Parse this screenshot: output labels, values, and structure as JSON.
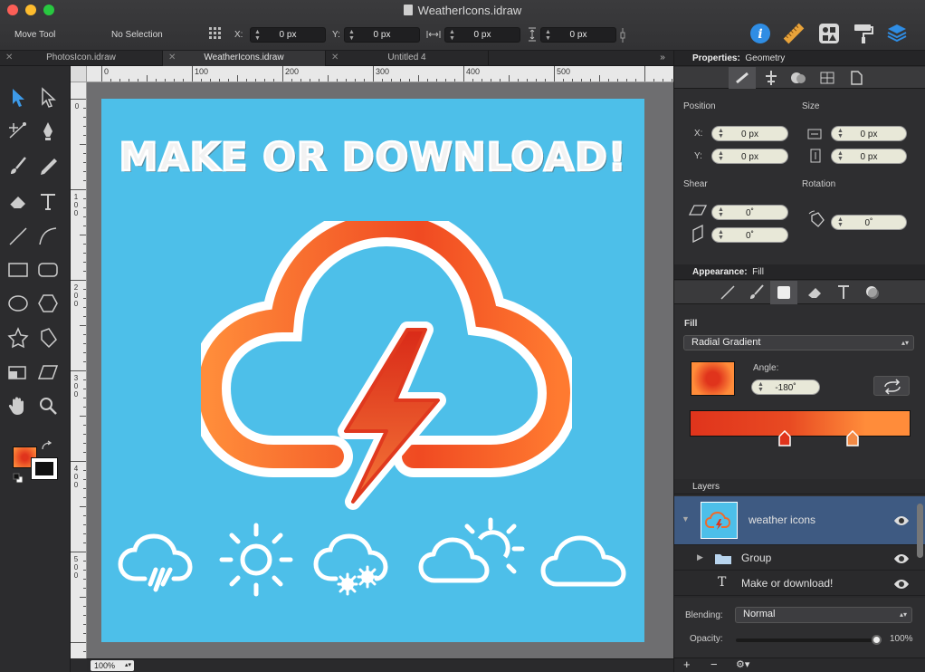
{
  "window": {
    "title": "WeatherIcons.idraw"
  },
  "toolbar": {
    "tool_name": "Move Tool",
    "selection": "No Selection",
    "x_label": "X:",
    "x_value": "0 px",
    "y_label": "Y:",
    "y_value": "0 px",
    "w_value": "0 px",
    "h_value": "0 px"
  },
  "tabs": [
    {
      "label": "PhotosIcon.idraw"
    },
    {
      "label": "WeatherIcons.idraw"
    },
    {
      "label": "Untitled 4"
    }
  ],
  "tabs_overflow": "»",
  "ruler": {
    "top": [
      "0",
      "100",
      "200",
      "300",
      "400",
      "500"
    ],
    "left": [
      "0",
      "100",
      "200",
      "300",
      "400",
      "500"
    ]
  },
  "artboard": {
    "headline": "MAKE OR DOWNLOAD!"
  },
  "status": {
    "zoom": "100%"
  },
  "properties": {
    "header": "Properties:",
    "header_sub": "Geometry",
    "position_label": "Position",
    "size_label": "Size",
    "pos_x_label": "X:",
    "pos_x": "0 px",
    "pos_y_label": "Y:",
    "pos_y": "0 px",
    "width": "0 px",
    "height": "0 px",
    "shear_label": "Shear",
    "rotation_label": "Rotation",
    "shear_h": "0˚",
    "shear_v": "0˚",
    "rotation": "0˚"
  },
  "appearance": {
    "header": "Appearance:",
    "header_sub": "Fill",
    "fill_label": "Fill",
    "fill_type": "Radial Gradient",
    "angle_label": "Angle:",
    "angle": "-180˚",
    "gradient_start": "#e0341c",
    "gradient_end": "#ff8c3a"
  },
  "layers": {
    "header": "Layers",
    "items": [
      {
        "name": "weather icons"
      },
      {
        "name": "Group"
      },
      {
        "name": "Make or download!"
      }
    ],
    "blending_label": "Blending:",
    "blending": "Normal",
    "opacity_label": "Opacity:",
    "opacity": "100%"
  },
  "colors": {
    "accent": "#3d9ae8",
    "canvas_bg": "#4dbfe9",
    "selected_layer": "#3e5a82"
  }
}
